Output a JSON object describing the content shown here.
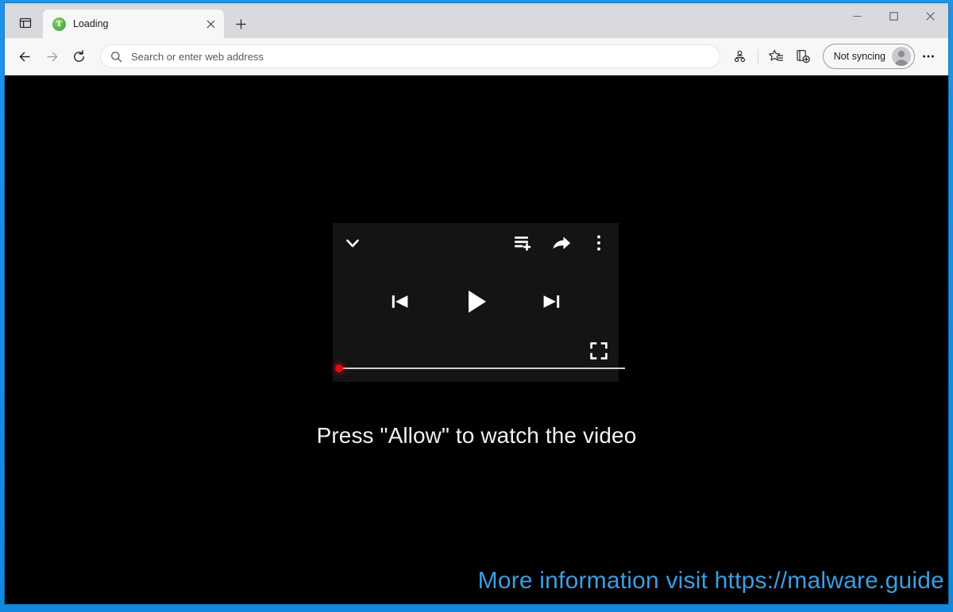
{
  "desktop": {
    "background_color": "#1a8fe3"
  },
  "browser": {
    "name": "microsoft-edge",
    "tabstrip": {
      "tab_actions_icon": "tab-actions-icon",
      "tabs": [
        {
          "title": "Loading",
          "favicon": "green-circle-favicon",
          "favicon_letter": "T",
          "favicon_color": "#58b44a",
          "close_icon": "close-icon",
          "active": true
        }
      ],
      "new_tab_icon": "plus-icon",
      "new_tab_label": "+"
    },
    "window_controls": {
      "minimize_icon": "minimize-icon",
      "maximize_icon": "maximize-icon",
      "close_icon": "close-icon"
    },
    "toolbar": {
      "back_icon": "back-arrow-icon",
      "forward_icon": "forward-arrow-icon",
      "refresh_icon": "refresh-icon",
      "address_bar": {
        "search_icon": "search-icon",
        "value": "",
        "placeholder": "Search or enter web address"
      },
      "tracking_prevention_icon": "tracking-prevention-icon",
      "favorites_icon": "favorites-star-icon",
      "collections_icon": "collections-icon",
      "profile": {
        "label": "Not syncing",
        "avatar_icon": "user-avatar-icon"
      },
      "settings_icon": "more-options-icon",
      "settings_label": "•••"
    }
  },
  "page": {
    "background_color": "#000000",
    "player": {
      "name": "video-player",
      "collapse_icon": "chevron-down-icon",
      "add_to_queue_icon": "add-to-queue-icon",
      "share_icon": "share-arrow-icon",
      "more_icon": "kebab-menu-icon",
      "previous_icon": "previous-track-icon",
      "play_icon": "play-icon",
      "next_icon": "next-track-icon",
      "fullscreen_icon": "fullscreen-icon",
      "progress": {
        "value_percent": 0,
        "thumb_color": "#e50914",
        "track_color": "#cfcfcf"
      }
    },
    "message": "Press \"Allow\" to watch the video",
    "watermark": {
      "text": "More information visit https://malware.guide",
      "color": "#3c9ee0"
    }
  }
}
